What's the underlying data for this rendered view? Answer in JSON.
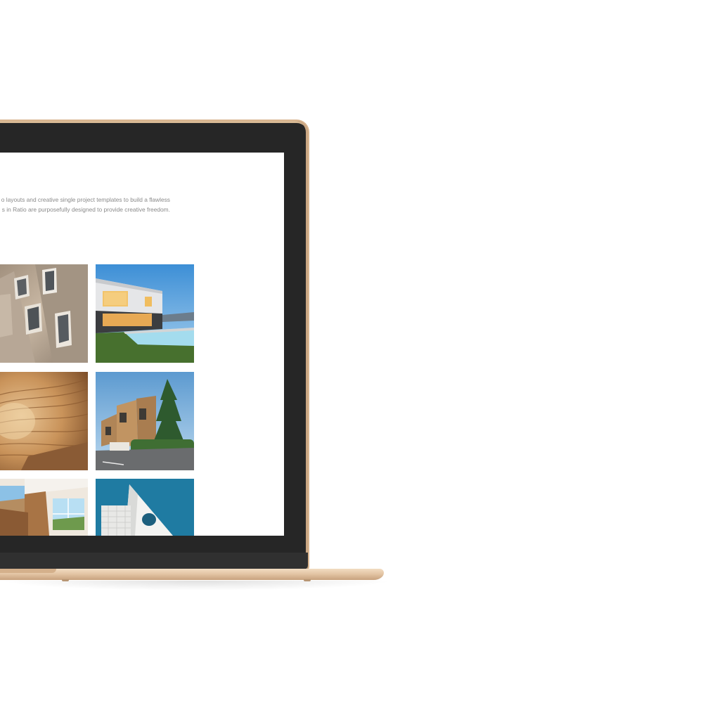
{
  "screen": {
    "description_lines": [
      "o layouts and creative single project templates to build a flawless",
      "s in Ratio are purposefully designed to provide creative freedom."
    ]
  },
  "gallery": {
    "tiles": [
      {
        "name": "facade-windows-photo",
        "subject": "angled metal facade with protruding windows"
      },
      {
        "name": "modern-villa-pool-photo",
        "subject": "modern white villa with pool at dusk"
      },
      {
        "name": "wooden-vault-interior-photo",
        "subject": "curved wooden slat ceiling"
      },
      {
        "name": "wood-houses-tree-photo",
        "subject": "wooden townhouses with pine tree"
      },
      {
        "name": "wood-interior-windows-photo",
        "subject": "timber interior with large windows"
      },
      {
        "name": "white-tower-blue-sky-photo",
        "subject": "white building with round window against teal sky"
      }
    ]
  },
  "colors": {
    "lid": "#262626",
    "gold_trim": "#d8b48f",
    "text_gray": "#8a8a8a"
  }
}
